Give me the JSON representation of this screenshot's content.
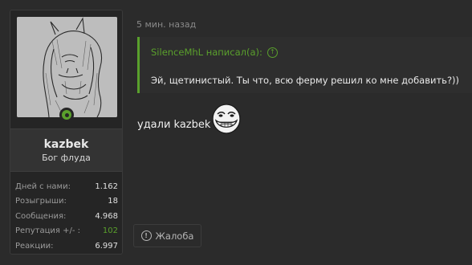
{
  "user": {
    "name": "kazbek",
    "title": "Бог флуда",
    "online_status": "online",
    "avatar_icon": "donkey-portrait-avatar",
    "stats": [
      {
        "label": "Дней с нами:",
        "value": "1.162"
      },
      {
        "label": "Розыгрыши:",
        "value": "18"
      },
      {
        "label": "Сообщения:",
        "value": "4.968"
      },
      {
        "label": "Репутация +/- :",
        "value": "102"
      },
      {
        "label": "Реакции:",
        "value": "6.997"
      }
    ]
  },
  "post": {
    "timestamp": "5 мин. назад",
    "quote": {
      "author_line": "SilenceMhL написал(а):",
      "icon": "arrow-up-circle-icon",
      "text": "Эй, щетинистый. Ты что, всю ферму решил ко мне добавить?))"
    },
    "message": "удали kazbek",
    "emoji": "troll-face-smiley",
    "report_label": "Жалоба",
    "report_icon": "exclamation-circle-icon"
  },
  "colors": {
    "accent": "#5aa02c",
    "background": "#2b2b2b",
    "card": "#252525"
  }
}
